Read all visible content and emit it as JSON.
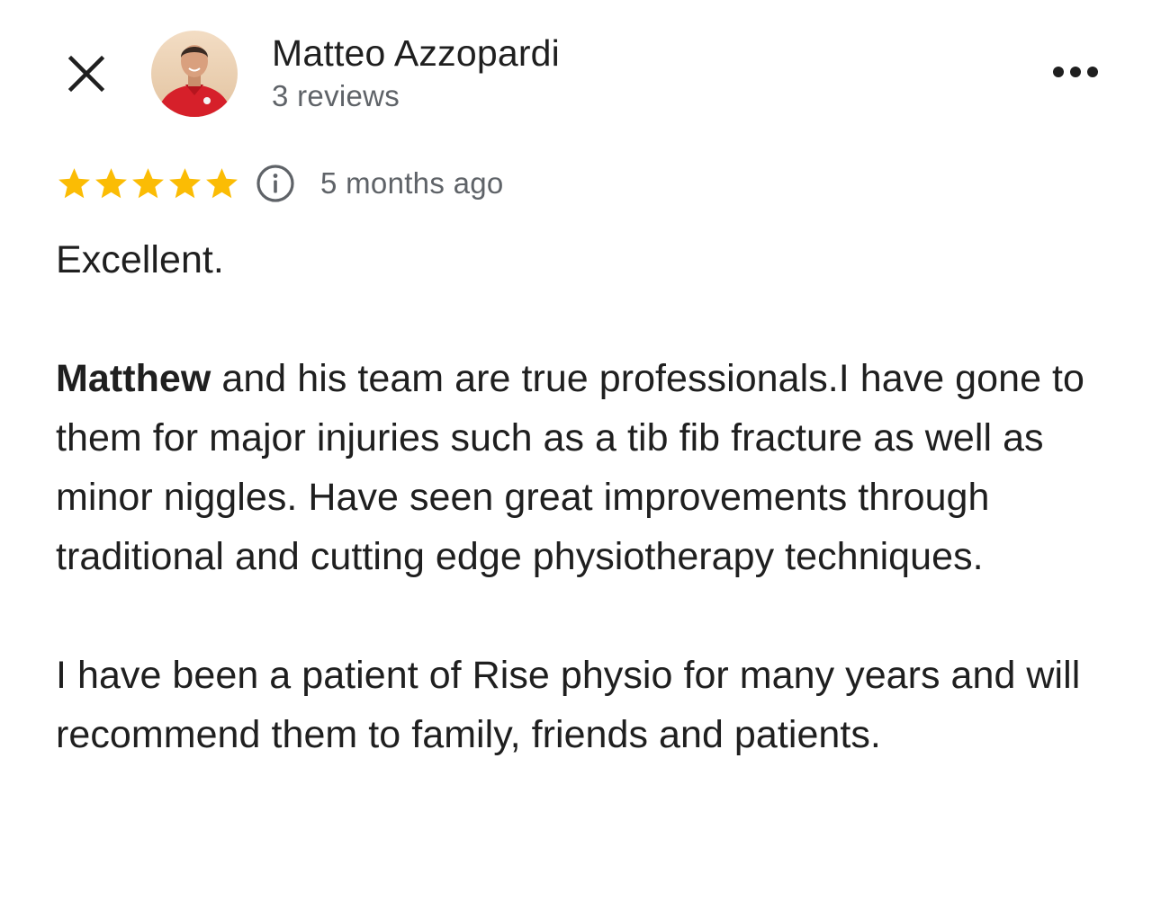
{
  "header": {
    "close_icon": "close-icon",
    "user_name": "Matteo Azzopardi",
    "review_count": "3 reviews",
    "more_icon": "more-options-icon"
  },
  "rating": {
    "stars": 5,
    "max_stars": 5,
    "star_color": "#fbbc04",
    "info_icon": "info-icon",
    "time_ago": "5 months ago"
  },
  "review": {
    "line_1": "Excellent.",
    "para_2_bold": "Matthew",
    "para_2_rest": " and his team are true professionals.I have gone to them for major injuries such as a tib fib fracture as well as minor niggles. Have seen great improvements through traditional and cutting edge physiotherapy techniques.",
    "para_3": "I have been a patient of Rise physio for many years and will recommend them to family, friends and patients."
  },
  "colors": {
    "text_primary": "#1f1f1f",
    "text_secondary": "#5f6368",
    "avatar_shirt": "#d6202a"
  }
}
